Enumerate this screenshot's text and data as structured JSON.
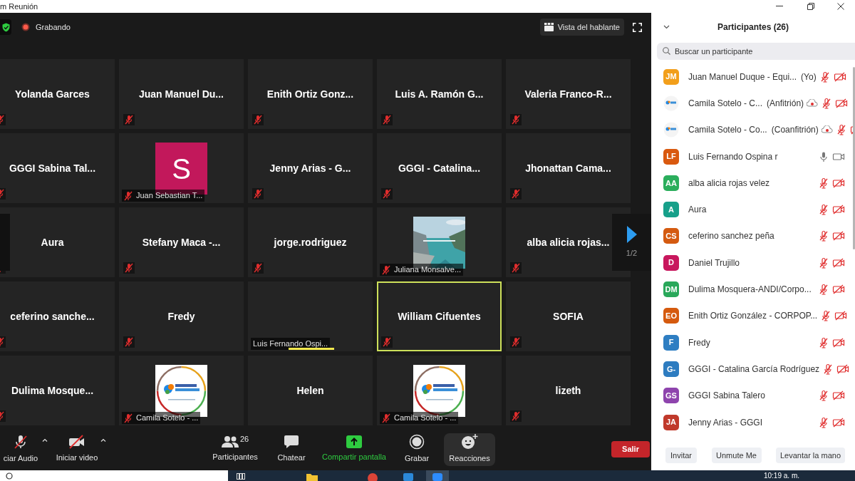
{
  "window": {
    "title": "m Reunión"
  },
  "top_bar": {
    "recording_label": "Grabando",
    "view_button": "Vista del hablante"
  },
  "tiles": [
    {
      "kind": "name",
      "name": "Yolanda Garces",
      "muted": true,
      "active_speaker": false,
      "talking": false
    },
    {
      "kind": "name",
      "name": "Juan Manuel Du...",
      "muted": true,
      "active_speaker": false,
      "talking": false
    },
    {
      "kind": "name",
      "name": "Enith Ortiz Gonz...",
      "muted": true,
      "active_speaker": false,
      "talking": false
    },
    {
      "kind": "name",
      "name": "Luis A. Ramón G...",
      "muted": true,
      "active_speaker": false,
      "talking": false
    },
    {
      "kind": "name",
      "name": "Valeria Franco-R...",
      "muted": true,
      "active_speaker": false,
      "talking": false
    },
    {
      "kind": "name",
      "name": "GGGI Sabina Tal...",
      "muted": true,
      "active_speaker": false,
      "talking": false
    },
    {
      "kind": "avatar",
      "letter": "S",
      "name": "Juan Sebastian T...",
      "muted": true,
      "active_speaker": false,
      "talking": false
    },
    {
      "kind": "name",
      "name": "Jenny Arias - G...",
      "muted": true,
      "active_speaker": false,
      "talking": false
    },
    {
      "kind": "name",
      "name": "GGGI - Catalina...",
      "muted": true,
      "active_speaker": false,
      "talking": false
    },
    {
      "kind": "name",
      "name": "Jhonattan Cama...",
      "muted": true,
      "active_speaker": false,
      "talking": false
    },
    {
      "kind": "name",
      "name": "Aura",
      "muted": true,
      "active_speaker": false,
      "talking": false
    },
    {
      "kind": "name",
      "name": "Stefany Maca -...",
      "muted": true,
      "active_speaker": false,
      "talking": false
    },
    {
      "kind": "name",
      "name": "jorge.rodriguez",
      "muted": true,
      "active_speaker": false,
      "talking": false
    },
    {
      "kind": "picture",
      "name": "Juliana Monsalve...",
      "muted": true,
      "active_speaker": false,
      "talking": false
    },
    {
      "kind": "name",
      "name": "alba alicia rojas...",
      "muted": true,
      "active_speaker": false,
      "talking": false
    },
    {
      "kind": "name",
      "name": "ceferino sanche...",
      "muted": true,
      "active_speaker": false,
      "talking": false
    },
    {
      "kind": "name",
      "name": "Fredy",
      "muted": true,
      "active_speaker": false,
      "talking": false
    },
    {
      "kind": "label",
      "name": "Luis Fernando Ospi...",
      "muted": false,
      "active_speaker": false,
      "talking": true
    },
    {
      "kind": "name",
      "name": "William Cifuentes",
      "muted": true,
      "active_speaker": true,
      "talking": false
    },
    {
      "kind": "name",
      "name": "SOFIA",
      "muted": true,
      "active_speaker": false,
      "talking": false
    },
    {
      "kind": "name",
      "name": "Dulima Mosque...",
      "muted": true,
      "active_speaker": false,
      "talking": false
    },
    {
      "kind": "logo",
      "name": "Camila Sotelo - ...",
      "muted": true,
      "active_speaker": false,
      "talking": false
    },
    {
      "kind": "name",
      "name": "Helen",
      "muted": false,
      "active_speaker": false,
      "talking": false
    },
    {
      "kind": "logo",
      "name": "Camila Sotelo - ...",
      "muted": true,
      "active_speaker": false,
      "talking": false
    },
    {
      "kind": "name",
      "name": "lizeth",
      "muted": true,
      "active_speaker": false,
      "talking": false
    }
  ],
  "pager": {
    "page": "1/2"
  },
  "toolbar": {
    "buttons": [
      {
        "kind": "audio",
        "label": "ciar Audio",
        "has_menu": true,
        "selected": false
      },
      {
        "kind": "video",
        "label": "Iniciar video",
        "has_menu": true,
        "selected": false
      },
      {
        "kind": "participants",
        "label": "Participantes",
        "count": "26",
        "has_menu": false,
        "selected": false
      },
      {
        "kind": "chat",
        "label": "Chatear",
        "has_menu": false,
        "selected": false
      },
      {
        "kind": "share",
        "label": "Compartir pantalla",
        "has_menu": false,
        "selected": false
      },
      {
        "kind": "record",
        "label": "Grabar",
        "has_menu": false,
        "selected": false
      },
      {
        "kind": "reactions",
        "label": "Reacciones",
        "has_menu": false,
        "selected": true
      }
    ],
    "leave": "Salir"
  },
  "panel": {
    "title": "Participantes (26)",
    "search_placeholder": "Buscar un participante",
    "participants": [
      {
        "kind": "initials",
        "initials": "JM",
        "color": "#f29f1b",
        "name": "Juan Manuel Duque - Equi...",
        "role": "(Yo)",
        "recording": false,
        "muted": true,
        "camera_on": false
      },
      {
        "kind": "logo",
        "name": "Camila Sotelo - C...",
        "role": "(Anfitrión)",
        "recording": true,
        "muted": true,
        "camera_on": false
      },
      {
        "kind": "logo",
        "name": "Camila Sotelo - Co...",
        "role": "(Coanfitrión)",
        "recording": true,
        "muted": true,
        "camera_on": false
      },
      {
        "kind": "initials",
        "initials": "LF",
        "color": "#d9590f",
        "name": "Luis Fernando Ospina r",
        "recording": false,
        "muted": false,
        "camera_on": true
      },
      {
        "kind": "initials",
        "initials": "AA",
        "color": "#2bae5c",
        "name": "alba alicia rojas velez",
        "recording": false,
        "muted": true,
        "camera_on": false
      },
      {
        "kind": "initials",
        "initials": "A",
        "color": "#17a08a",
        "name": "Aura",
        "recording": false,
        "muted": true,
        "camera_on": false
      },
      {
        "kind": "initials",
        "initials": "CS",
        "color": "#d45a10",
        "name": "ceferino sanchez peña",
        "recording": false,
        "muted": true,
        "camera_on": false
      },
      {
        "kind": "initials",
        "initials": "D",
        "color": "#c8175d",
        "name": "Daniel Trujillo",
        "recording": false,
        "muted": true,
        "camera_on": false
      },
      {
        "kind": "initials",
        "initials": "DM",
        "color": "#29a85a",
        "name": "Dulima Mosquera-ANDI/Corpo...",
        "recording": false,
        "muted": true,
        "camera_on": false
      },
      {
        "kind": "initials",
        "initials": "EO",
        "color": "#d55a0e",
        "name": "Enith Ortiz González - CORPOP...",
        "recording": false,
        "muted": true,
        "camera_on": false
      },
      {
        "kind": "initials",
        "initials": "F",
        "color": "#2e7ec2",
        "name": "Fredy",
        "recording": false,
        "muted": true,
        "camera_on": false
      },
      {
        "kind": "initials",
        "initials": "G-",
        "color": "#2d7cc0",
        "name": "GGGI - Catalina García Rodríguez",
        "recording": false,
        "muted": true,
        "camera_on": false
      },
      {
        "kind": "initials",
        "initials": "GS",
        "color": "#8e44ad",
        "name": "GGGI Sabina Talero",
        "recording": false,
        "muted": true,
        "camera_on": false
      },
      {
        "kind": "initials",
        "initials": "JA",
        "color": "#c0392b",
        "name": "Jenny Arias - GGGI",
        "recording": false,
        "muted": true,
        "camera_on": false
      }
    ],
    "buttons": [
      "Invitar",
      "Unmute Me",
      "Levantar la mano"
    ]
  },
  "taskbar": {
    "time": "10:19 a. m."
  }
}
